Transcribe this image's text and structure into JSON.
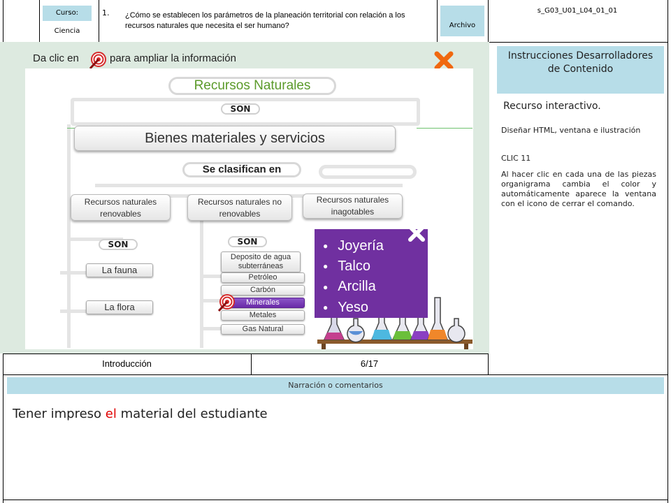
{
  "header": {
    "course_label": "Curso:",
    "course_value": "Ciencia",
    "number": "1.",
    "question": "¿Cómo se establecen los parámetros de la planeación territorial con relación a los recursos naturales que necesita el ser humano?",
    "file_label": "Archivo",
    "code": "s_G03_U01_L04_01_01"
  },
  "slide": {
    "instruction_before": "Da clic en",
    "instruction_after": "para ampliar la información",
    "title": "Recursos Naturales",
    "son_1": "SON",
    "bienes": "Bienes materiales y servicios",
    "clasifican": "Se clasifican en",
    "cat_renovables": "Recursos naturales renovables",
    "cat_no_renovables": "Recursos naturales no renovables",
    "cat_inagotables": "Recursos naturales inagotables",
    "son_2": "SON",
    "son_3": "SON",
    "fauna": "La fauna",
    "flora": "La flora",
    "deposito": "Deposito de agua subterráneas",
    "petroleo": "Petróleo",
    "carbon": "Carbón",
    "minerales": "Minerales",
    "metales": "Metales",
    "gas": "Gas Natural",
    "popup_items": [
      "Joyería",
      "Talco",
      "Arcilla",
      "Yeso"
    ]
  },
  "footer_row": {
    "section": "Introducción",
    "page": "6/17"
  },
  "side": {
    "title": "Instrucciones Desarrolladores de Contenido",
    "subtitle": "Recurso interactivo.",
    "p1": "Diseñar HTML, ventana e ilustración",
    "p2": "CLIC 11",
    "p3": "Al hacer clic en cada una de las piezas organigrama cambia el color y automáticamente aparece la ventana con el icono de cerrar el comando."
  },
  "narration": {
    "label": "Narración o comentarios",
    "text_before": "Tener impreso ",
    "text_highlight": "el",
    "text_after": " material del estudiante"
  },
  "colors": {
    "header_blue": "#b7dde8",
    "popup_purple": "#7030a0",
    "close_orange": "#f0680f",
    "title_green": "#5b9a2a",
    "highlight_red": "#e00000"
  }
}
